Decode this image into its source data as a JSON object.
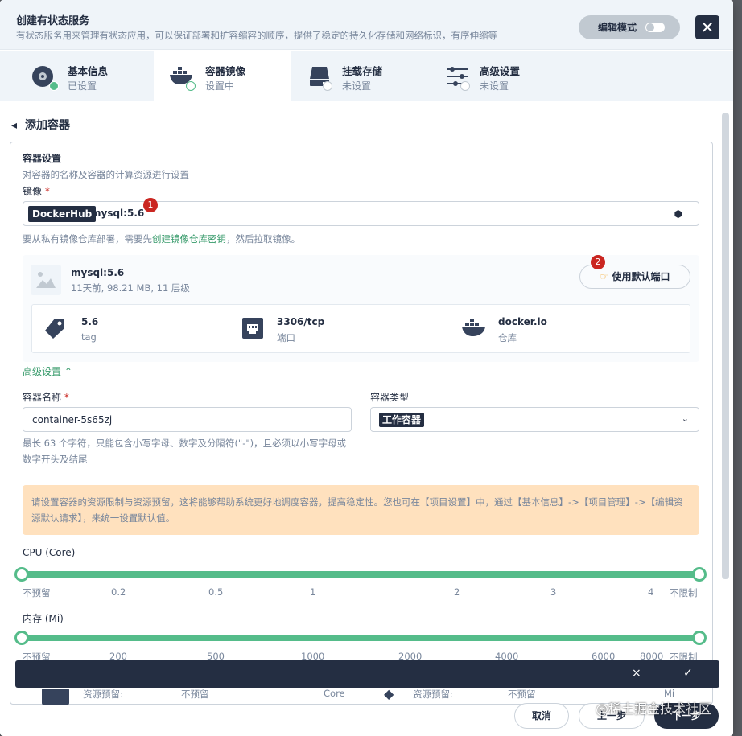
{
  "header": {
    "title": "创建有状态服务",
    "subtitle": "有状态服务用来管理有状态应用，可以保证部署和扩容缩容的顺序，提供了稳定的持久化存储和网络标识，有序伸缩等",
    "edit_mode_label": "编辑模式"
  },
  "steps": [
    {
      "label": "基本信息",
      "status": "已设置"
    },
    {
      "label": "容器镜像",
      "status": "设置中"
    },
    {
      "label": "挂载存储",
      "status": "未设置"
    },
    {
      "label": "高级设置",
      "status": "未设置"
    }
  ],
  "page": {
    "back_title": "添加容器"
  },
  "container_settings": {
    "title": "容器设置",
    "desc": "对容器的名称及容器的计算资源进行设置",
    "image_label": "镜像",
    "registry_tag": "DockerHub",
    "image_value": "mysql:5.6",
    "marker_1": "1",
    "marker_2": "2",
    "hint_prefix": "要从私有镜像仓库部署，需要先",
    "hint_link": "创建镜像仓库密钥",
    "hint_suffix": "，然后拉取镜像。"
  },
  "image_info": {
    "name": "mysql:5.6",
    "meta": "11天前, 98.21 MB, 11 层级",
    "default_port_button": "使用默认端口",
    "props": [
      {
        "value": "5.6",
        "label": "tag",
        "icon": "tag-icon"
      },
      {
        "value": "3306/tcp",
        "label": "端口",
        "icon": "port-icon"
      },
      {
        "value": "docker.io",
        "label": "仓库",
        "icon": "docker-icon"
      }
    ]
  },
  "advanced": {
    "toggle_label": "高级设置"
  },
  "container_name": {
    "label": "容器名称",
    "value": "container-5s65zj",
    "help": "最长 63 个字符，只能包含小写字母、数字及分隔符(\"-\")，且必须以小写字母或数字开头及结尾"
  },
  "container_type": {
    "label": "容器类型",
    "value": "工作容器"
  },
  "warning": "请设置容器的资源限制与资源预留，这将能够帮助系统更好地调度容器，提高稳定性。您也可在【项目设置】中，通过【基本信息】->【项目管理】->【编辑资源默认请求】，来统一设置默认值。",
  "cpu": {
    "label": "CPU (Core)",
    "ticks": [
      "不预留",
      "0.2",
      "0.5",
      "1",
      "2",
      "3",
      "4",
      "不限制"
    ],
    "reserve_fraction": 0,
    "limit_fraction": 1
  },
  "memory": {
    "label": "内存 (Mi)",
    "ticks": [
      "不预留",
      "200",
      "500",
      "1000",
      "2000",
      "4000",
      "6000",
      "8000",
      "不限制"
    ],
    "reserve_fraction": 0,
    "limit_fraction": 1
  },
  "bottom_bar": {
    "cancel_icon": "×",
    "confirm_icon": "✓"
  },
  "peek": {
    "reserve_label_a": "资源预留:",
    "value_a": "不预留",
    "unit_a": "Core",
    "reserve_label_b": "资源预留:",
    "value_b": "不预留",
    "unit_b": "Mi"
  },
  "footer": {
    "cancel": "取消",
    "prev": "上一步",
    "next": "下一步"
  },
  "watermark": "@稀土掘金技术社区",
  "colors": {
    "primary": "#242e42",
    "accent": "#55bc8a",
    "link": "#369a6a",
    "danger": "#ca2621",
    "warning_bg": "#ffe1be"
  }
}
